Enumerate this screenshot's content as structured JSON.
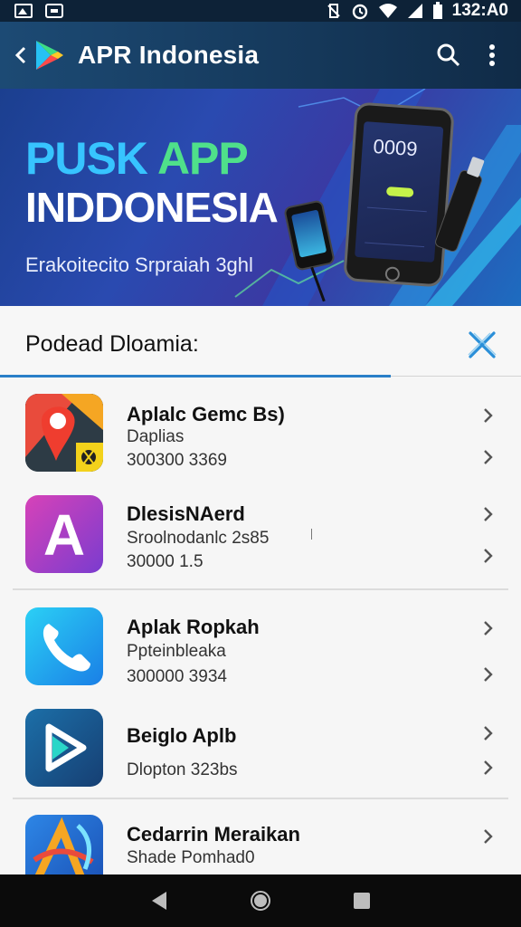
{
  "status_bar": {
    "time": "132:A0",
    "left_icons": [
      "image-icon",
      "sim-icon"
    ],
    "right_icons": [
      "vibrate-icon",
      "alarm-icon",
      "wifi-icon",
      "signal-icon",
      "battery-icon"
    ]
  },
  "app_bar": {
    "title": "APR Indonesia",
    "icons": [
      "back-icon",
      "play-logo-icon",
      "search-icon",
      "more-vert-icon"
    ]
  },
  "banner": {
    "title_part1": "PUSK ",
    "title_part2": "APP",
    "title_line2": "INDDONESIA",
    "subtitle": "Erakoitecito Srpraiah 3ghl",
    "phone_time": "0009",
    "colors": {
      "title_part1": "#37c4ff",
      "title_part2": "#4fe08a"
    }
  },
  "section": {
    "title": "Podead Dloamia:",
    "close_icon": "close-icon",
    "accent": "#2a7fc8"
  },
  "apps": [
    {
      "name": "Aplalc Gemc Bs)",
      "line1": "Daplias",
      "line2": "300300 3369",
      "icon": "maps-app-icon"
    },
    {
      "name": "DlesisNAerd",
      "line1": "Sroolnodanlc 2s85",
      "line2": "30000 1.5",
      "icon": "letter-a-app-icon",
      "letter": "A"
    },
    {
      "name": "Aplak Ropkah",
      "line1": "Ppteinbleaka",
      "line2": "300000 3934",
      "icon": "phone-app-icon"
    },
    {
      "name": "Beiglo Aplb",
      "line1": "Dlopton 323bs",
      "icon": "play-app-icon"
    },
    {
      "name": "Cedarrin Meraikan",
      "line1": "Shade Pomhad0",
      "icon": "art-app-icon"
    }
  ],
  "nav_bar": {
    "icons": [
      "nav-back-icon",
      "nav-home-icon",
      "nav-recents-icon"
    ]
  }
}
